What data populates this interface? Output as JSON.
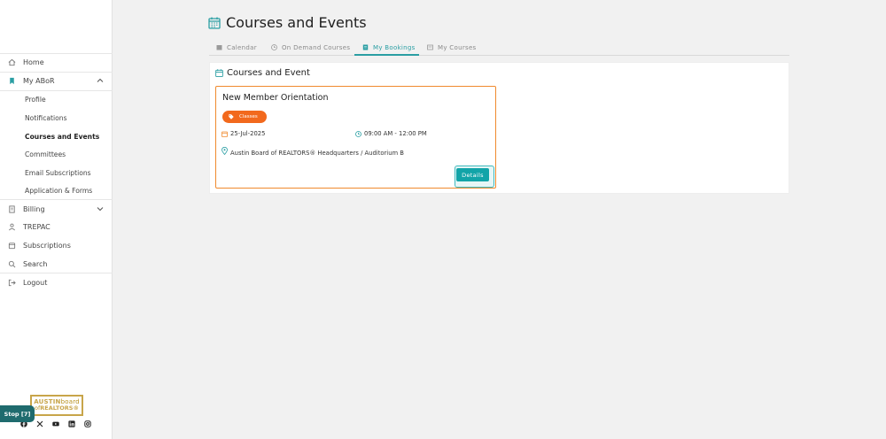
{
  "sidebar": {
    "items": [
      {
        "label": "Home",
        "icon": "home-icon"
      },
      {
        "label": "My ABoR",
        "icon": "bookmark-icon"
      },
      {
        "label": "Billing",
        "icon": "billing-icon"
      },
      {
        "label": "TREPAC",
        "icon": "trepac-icon"
      },
      {
        "label": "Subscriptions",
        "icon": "subscriptions-icon"
      },
      {
        "label": "Search",
        "icon": "search-icon"
      },
      {
        "label": "Logout",
        "icon": "logout-icon"
      }
    ],
    "subitems": [
      {
        "label": "Profile"
      },
      {
        "label": "Notifications"
      },
      {
        "label": "Courses and Events",
        "active": true
      },
      {
        "label": "Committees"
      },
      {
        "label": "Email Subscriptions"
      },
      {
        "label": "Application & Forms"
      }
    ],
    "logo": {
      "line1_bold": "AUSTIN",
      "line1_light": "board",
      "line2_light": "of",
      "line2_bold": "REALTORS",
      "line2_mark": "®"
    },
    "stop_label": "Stop [7]",
    "socials": [
      "facebook-icon",
      "x-icon",
      "youtube-icon",
      "linkedin-icon",
      "instagram-icon"
    ]
  },
  "page": {
    "title": "Courses and Events",
    "tabs": [
      {
        "label": "Calendar",
        "icon": "calendar-tab-icon"
      },
      {
        "label": "On Demand Courses",
        "icon": "clock-tab-icon"
      },
      {
        "label": "My Bookings",
        "icon": "bookings-tab-icon",
        "active": true
      },
      {
        "label": "My Courses",
        "icon": "courses-tab-icon"
      }
    ]
  },
  "panel": {
    "title": "Courses and Event",
    "event": {
      "title": "New Member Orientation",
      "tag": "Classes",
      "date": "25-Jul-2025",
      "time": "09:00 AM - 12:00 PM",
      "location": "Austin Board of REALTORS® Headquarters / Auditorium B",
      "details_label": "Details"
    }
  },
  "colors": {
    "accent": "#2a9ea3",
    "orange": "#f2691d",
    "card_border": "#f08a2e",
    "logo_gold": "#c8a54a"
  }
}
